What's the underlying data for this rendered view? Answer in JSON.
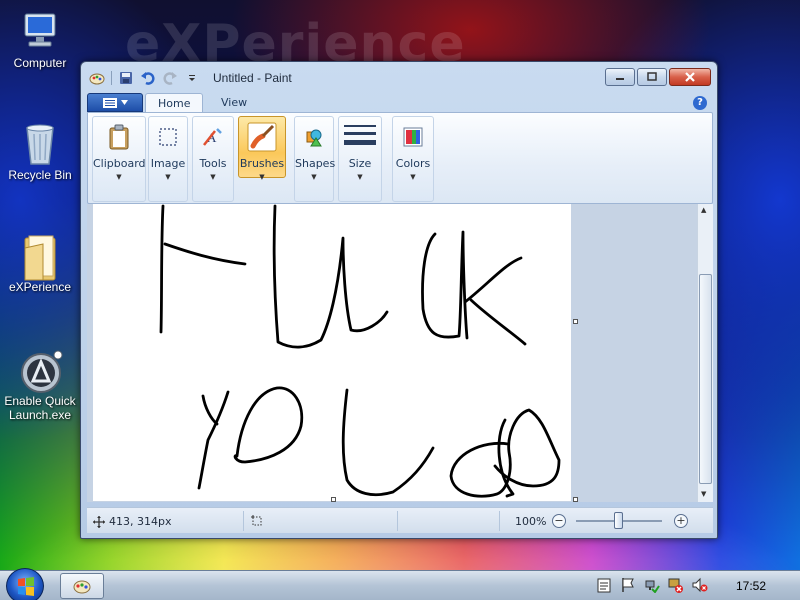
{
  "desktop": {
    "background_text": "eXPerience",
    "icons": [
      {
        "label": "Computer"
      },
      {
        "label": "Recycle Bin"
      },
      {
        "label": "eXPerience"
      },
      {
        "label": "Enable Quick Launch.exe"
      }
    ]
  },
  "window": {
    "title": "Untitled - Paint",
    "tabs": [
      {
        "label": "Home",
        "active": true
      },
      {
        "label": "View",
        "active": false
      }
    ],
    "help_label": "?",
    "ribbon": {
      "groups": [
        {
          "label": "Clipboard",
          "icon": "clipboard-icon"
        },
        {
          "label": "Image",
          "icon": "image-select-icon"
        },
        {
          "label": "Tools",
          "icon": "tools-icon"
        },
        {
          "label": "Brushes",
          "icon": "brush-icon",
          "selected": true
        },
        {
          "label": "Shapes",
          "icon": "shapes-icon"
        },
        {
          "label": "Size",
          "icon": "size-lines-icon"
        },
        {
          "label": "Colors",
          "icon": "color-palette-icon"
        }
      ]
    },
    "status": {
      "cursor_position": "413, 314px",
      "zoom": "100%",
      "zoom_out_label": "−",
      "zoom_in_label": "+"
    }
  },
  "taskbar": {
    "clock": "17:52"
  },
  "colors": {
    "selected_group": "#fbc85a",
    "ribbon_text": "#1e395b"
  }
}
